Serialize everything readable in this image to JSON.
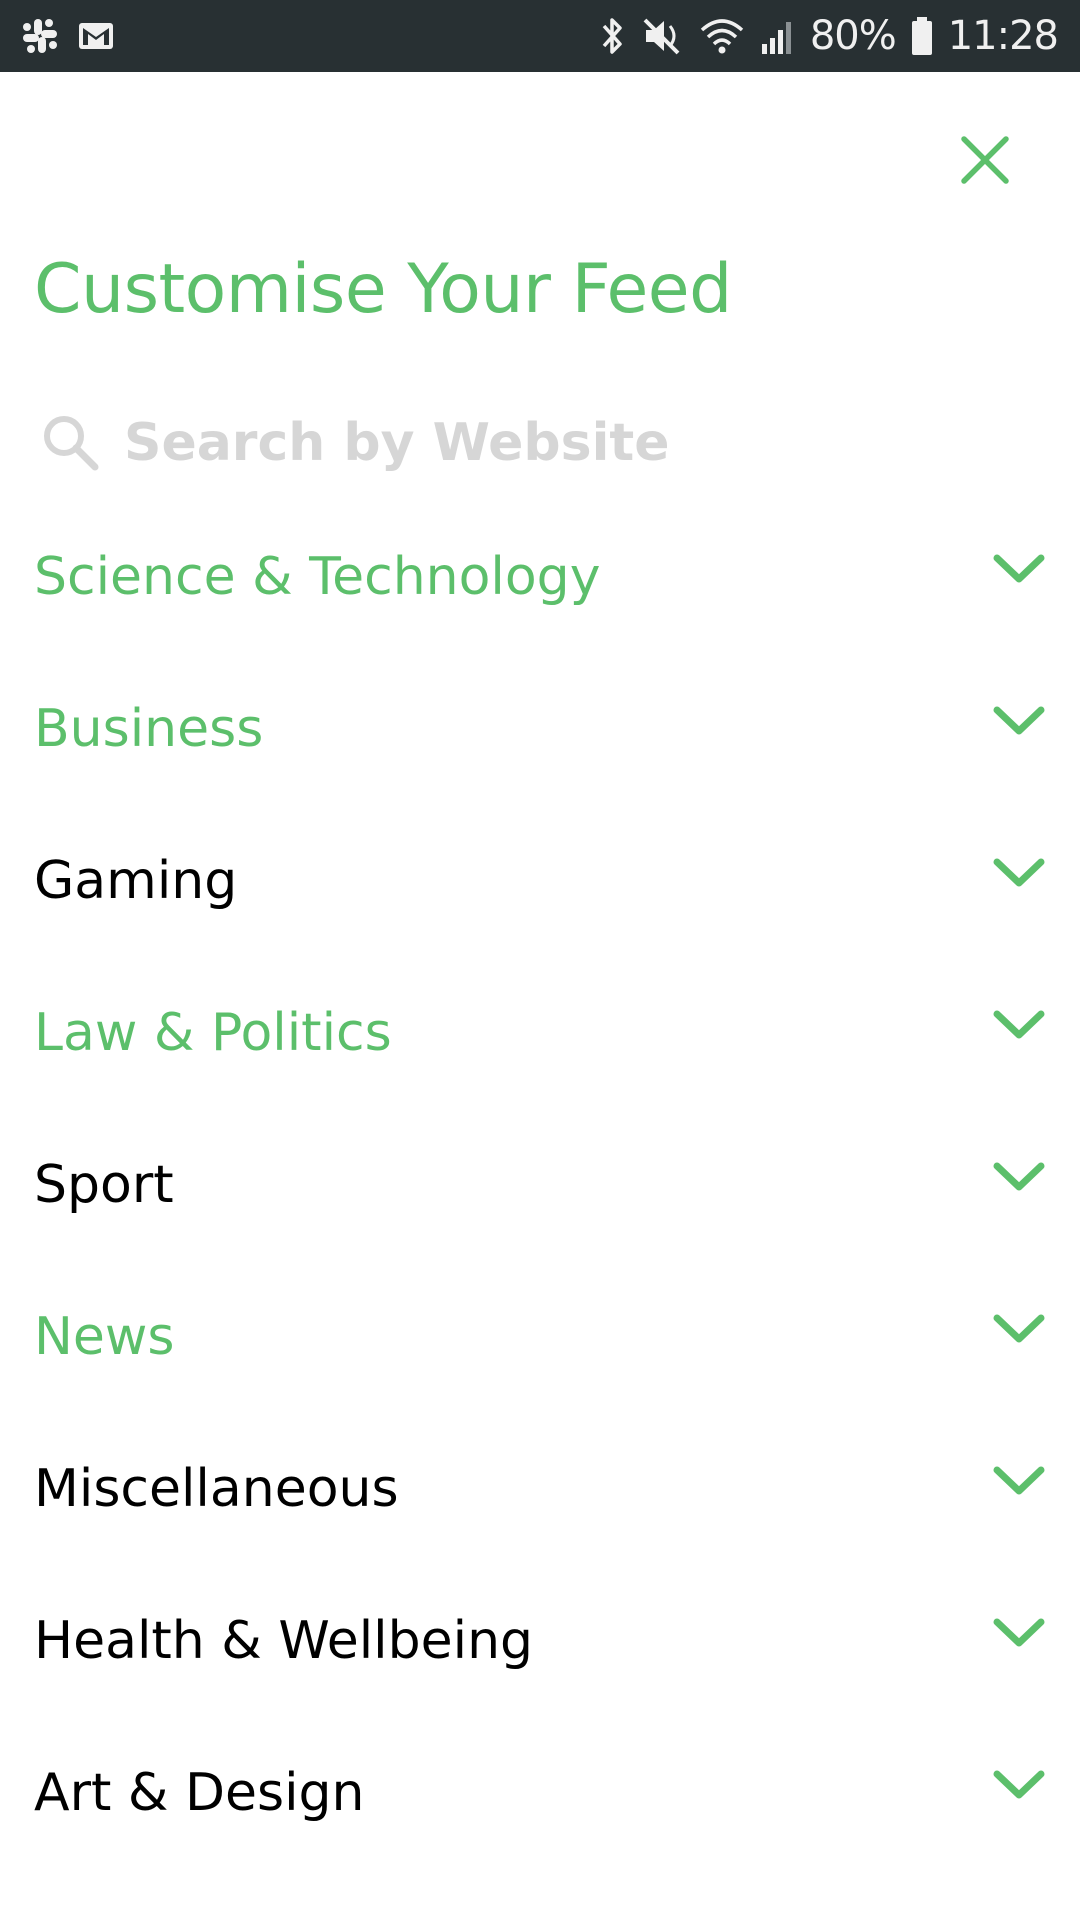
{
  "status_bar": {
    "left_icons": [
      "slack-icon",
      "gmail-icon"
    ],
    "right_icons": [
      "bluetooth-icon",
      "mute-icon",
      "wifi-icon",
      "signal-icon",
      "battery-icon"
    ],
    "battery": "80%",
    "time": "11:28"
  },
  "colors": {
    "accent": "#5cbf6b",
    "status_bar_bg": "#283033",
    "unselected_text": "#000000",
    "placeholder": "#d6d6d6"
  },
  "header": {
    "close_icon": "close-icon",
    "title": "Customise Your Feed"
  },
  "search": {
    "icon": "search-icon",
    "placeholder": "Search by Website",
    "value": ""
  },
  "categories": [
    {
      "label": "Science & Technology",
      "selected": true
    },
    {
      "label": "Business",
      "selected": true
    },
    {
      "label": "Gaming",
      "selected": false
    },
    {
      "label": "Law & Politics",
      "selected": true
    },
    {
      "label": "Sport",
      "selected": false
    },
    {
      "label": "News",
      "selected": true
    },
    {
      "label": "Miscellaneous",
      "selected": false
    },
    {
      "label": "Health & Wellbeing",
      "selected": false
    },
    {
      "label": "Art & Design",
      "selected": false
    }
  ]
}
